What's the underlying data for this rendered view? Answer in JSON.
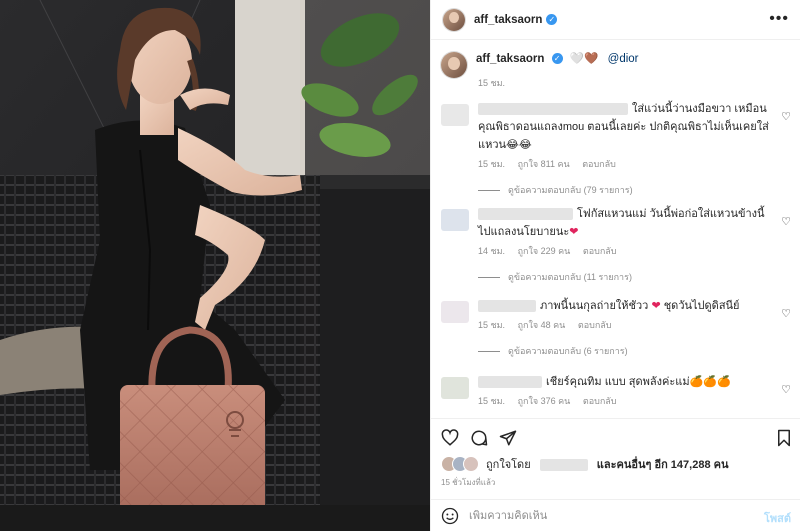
{
  "post": {
    "username": "aff_taksaorn",
    "caption_mention": "@dior",
    "caption_emoji": "🤍🤎",
    "caption_time": "15 ชม."
  },
  "comments": [
    {
      "text": "ใส่แว่นนี้ว่านงมือขวา เหมือนคุณพิธาดอนแถลงmou ตอนนี้เลยค่ะ ปกติคุณพิธาไม่เห็นเคยใส่แหวน😂😂",
      "time": "15 ชม.",
      "likes": "ถูกใจ 811 คน",
      "reply": "ตอบกลับ",
      "view_replies": "ดูข้อความตอบกลับ (79 รายการ)"
    },
    {
      "text": "โฟกัสแหวนแม่ วันนี้พ่อก่อใส่แหวนข้างนี้ไปแถลงนโยบายนะ",
      "heart": "❤",
      "time": "14 ชม.",
      "likes": "ถูกใจ 229 คน",
      "reply": "ตอบกลับ",
      "view_replies": "ดูข้อความตอบกลับ (11 รายการ)"
    },
    {
      "text": "ภาพนี้นนกุลถ่ายให้ชัวว",
      "heart": "❤",
      "text_after": "ชุดวันไปดูดิสนีย์",
      "time": "15 ชม.",
      "likes": "ถูกใจ 48 คน",
      "reply": "ตอบกลับ",
      "view_replies": "ดูข้อความตอบกลับ (6 รายการ)"
    },
    {
      "text": "เชียร์คุณทิม แบบ สุดพลังค่ะแม่🍊🍊🍊",
      "time": "15 ชม.",
      "likes": "ถูกใจ 376 คน",
      "reply": "ตอบกลับ"
    }
  ],
  "likes_summary": {
    "prefix": "ถูกใจโดย",
    "suffix": "และคนอื่นๆ อีก 147,288 คน"
  },
  "post_time": "15 ชั่วโมงที่แล้ว",
  "add_comment": {
    "placeholder": "เพิ่มความคิดเห็น",
    "post_label": "โพสต์"
  },
  "icons": {
    "more": "more-icon",
    "like": "heart-icon",
    "comment": "comment-icon",
    "share": "send-icon",
    "save": "bookmark-icon",
    "emoji": "smiley-icon"
  },
  "colors": {
    "verified": "#3897f0",
    "link": "#00376b",
    "secondary_text": "#8e8e8e",
    "post_button": "#b2dffc"
  }
}
